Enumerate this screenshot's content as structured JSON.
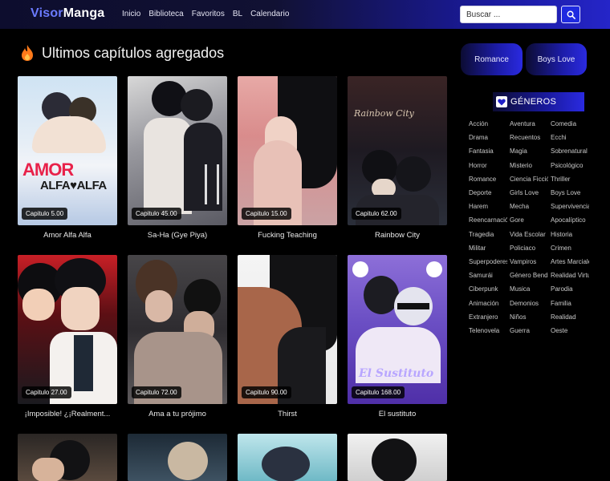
{
  "header": {
    "logo_part1": "Visor",
    "logo_part2": "Manga",
    "nav": [
      "Inicio",
      "Biblioteca",
      "Favoritos",
      "BL",
      "Calendario"
    ],
    "search_placeholder": "Buscar ..."
  },
  "section": {
    "title": "Ultimos capítulos agregados"
  },
  "cards": [
    {
      "title": "Amor Alfa Alfa",
      "chapter": "Capitulo 5.00"
    },
    {
      "title": "Sa-Ha (Gye Piya)",
      "chapter": "Capitulo 45.00"
    },
    {
      "title": "Fucking Teaching",
      "chapter": "Capitulo 15.00"
    },
    {
      "title": "Rainbow City",
      "chapter": "Capitulo 62.00"
    },
    {
      "title": "¡Imposible! ¿¡Realment...",
      "chapter": "Capitulo 27.00"
    },
    {
      "title": "Ama a tu prójimo",
      "chapter": "Capitulo 72.00"
    },
    {
      "title": "Thirst",
      "chapter": "Capitulo 90.00"
    },
    {
      "title": "El sustituto",
      "chapter": "Capitulo 168.00"
    }
  ],
  "cover_texts": {
    "amor": "AMOR",
    "alfa": "ALFA♥ALFA",
    "sustituto": "El Sustituto",
    "rainbow": "Rainbow City"
  },
  "sidebar": {
    "pills": [
      "Romance",
      "Boys Love"
    ],
    "genres_title": "GÉNEROS",
    "genres": [
      [
        "Acción",
        "Aventura",
        "Comedia"
      ],
      [
        "Drama",
        "Recuentos",
        "Ecchi"
      ],
      [
        "Fantasia",
        "Magia",
        "Sobrenatural"
      ],
      [
        "Horror",
        "Misterio",
        "Psicológico"
      ],
      [
        "Romance",
        "Ciencia Ficción",
        "Thriller"
      ],
      [
        "Deporte",
        "Girls Love",
        "Boys Love"
      ],
      [
        "Harem",
        "Mecha",
        "Supervivencia"
      ],
      [
        "Reencarnación",
        "Gore",
        "Apocalíptico"
      ],
      [
        "Tragedia",
        "Vida Escolar",
        "Historia"
      ],
      [
        "Militar",
        "Policiaco",
        "Crimen"
      ],
      [
        "Superpoderes",
        "Vampiros",
        "Artes Marciales"
      ],
      [
        "Samurái",
        "Género Bender",
        "Realidad Virtual"
      ],
      [
        "Ciberpunk",
        "Musica",
        "Parodia"
      ],
      [
        "Animación",
        "Demonios",
        "Familia"
      ],
      [
        "Extranjero",
        "Niños",
        "Realidad"
      ],
      [
        "Telenovela",
        "Guerra",
        "Oeste"
      ]
    ]
  },
  "colors": {
    "accent": "#1f2ae0",
    "logo_blue": "#6b7bff",
    "fire": "#ff7a1a"
  },
  "icons": {
    "search": "search-icon",
    "fire": "fire-icon",
    "heart": "heart-icon"
  }
}
